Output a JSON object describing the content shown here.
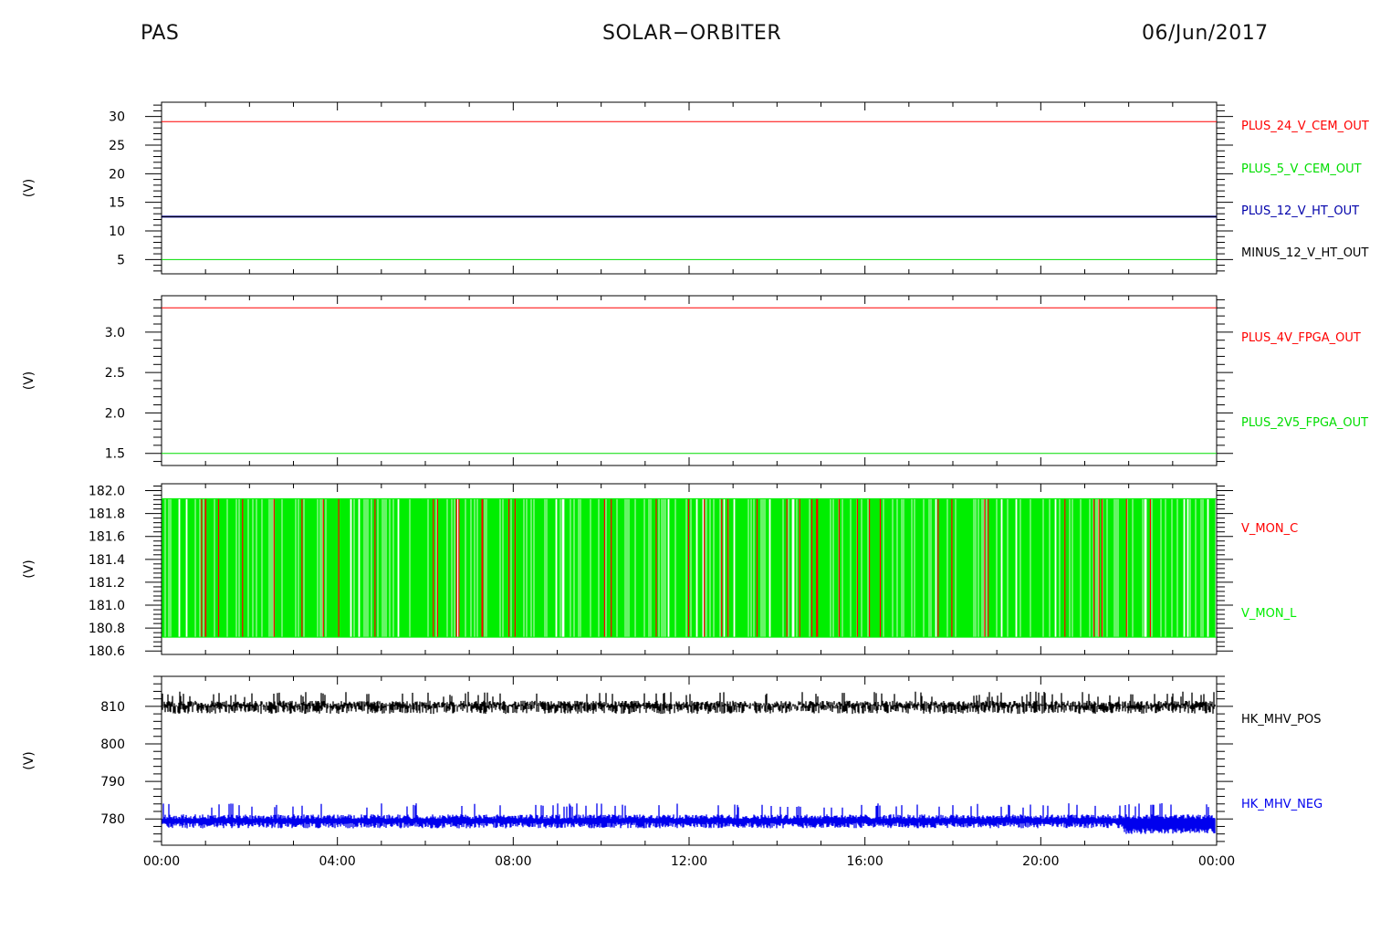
{
  "header": {
    "left": "PAS",
    "center": "SOLAR−ORBITER",
    "right": "06/Jun/2017"
  },
  "chart_data": [
    {
      "type": "line",
      "ylabel": "(V)",
      "ylim": [
        2.5,
        32.5
      ],
      "yticks": [
        5,
        10,
        15,
        20,
        25,
        30
      ],
      "ytick_labels": [
        "5",
        "10",
        "15",
        "20",
        "25",
        "30"
      ],
      "x": [
        "00:00",
        "24:00"
      ],
      "series": [
        {
          "name": "PLUS_24_V_CEM_OUT",
          "color": "#ff0000",
          "values": [
            29.1,
            29.1
          ]
        },
        {
          "name": "PLUS_5_V_CEM_OUT",
          "color": "#00dd00",
          "values": [
            5.0,
            5.0
          ]
        },
        {
          "name": "PLUS_12_V_HT_OUT",
          "color": "#0000aa",
          "values": [
            12.5,
            12.5
          ]
        },
        {
          "name": "MINUS_12_V_HT_OUT",
          "color": "#000000",
          "values": [
            12.5,
            12.5
          ]
        }
      ]
    },
    {
      "type": "line",
      "ylabel": "(V)",
      "ylim": [
        1.35,
        3.45
      ],
      "yticks": [
        1.5,
        2.0,
        2.5,
        3.0
      ],
      "ytick_labels": [
        "1.5",
        "2.0",
        "2.5",
        "3.0"
      ],
      "x": [
        "00:00",
        "24:00"
      ],
      "series": [
        {
          "name": "PLUS_4V_FPGA_OUT",
          "color": "#ff0000",
          "values": [
            3.3,
            3.3
          ]
        },
        {
          "name": "PLUS_2V5_FPGA_OUT",
          "color": "#00dd00",
          "values": [
            1.5,
            1.5
          ]
        }
      ]
    },
    {
      "type": "line",
      "ylabel": "(V)",
      "ylim": [
        180.57,
        182.06
      ],
      "yticks": [
        180.6,
        180.8,
        181.0,
        181.2,
        181.4,
        181.6,
        181.8,
        182.0
      ],
      "ytick_labels": [
        "180.6",
        "180.8",
        "181.0",
        "181.2",
        "181.4",
        "181.6",
        "181.8",
        "182.0"
      ],
      "x": [
        "00:00",
        "24:00"
      ],
      "series": [
        {
          "name": "V_MON_C",
          "color": "#ff0000",
          "range": [
            180.72,
            181.93
          ]
        },
        {
          "name": "V_MON_L",
          "color": "#00ee00",
          "range": [
            180.72,
            181.93
          ]
        }
      ]
    },
    {
      "type": "line",
      "ylabel": "(V)",
      "ylim": [
        773,
        818
      ],
      "yticks": [
        780,
        790,
        800,
        810
      ],
      "ytick_labels": [
        "780",
        "790",
        "800",
        "810"
      ],
      "x": [
        "00:00",
        "24:00"
      ],
      "series": [
        {
          "name": "HK_MHV_POS",
          "color": "#000000",
          "range": [
            808,
            814
          ]
        },
        {
          "name": "HK_MHV_NEG",
          "color": "#0000ee",
          "range": [
            776,
            784
          ]
        }
      ]
    }
  ],
  "xaxis": {
    "tick_labels": [
      "00:00",
      "04:00",
      "08:00",
      "12:00",
      "16:00",
      "20:00",
      "00:00"
    ]
  }
}
